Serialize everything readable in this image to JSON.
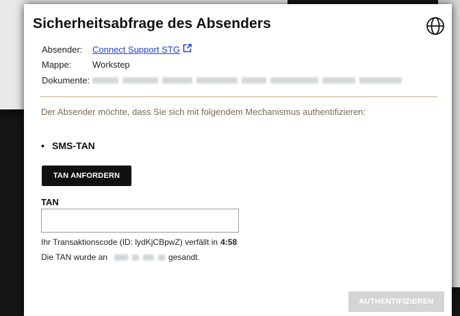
{
  "dialog": {
    "title": "Sicherheitsabfrage des Absenders",
    "language_icon": "globe-icon"
  },
  "meta": {
    "sender_label": "Absender:",
    "sender_name": "Connect Support STG",
    "sender_link_icon": "external-link-icon",
    "folder_label": "Mappe:",
    "folder_value": "Workstep",
    "documents_label": "Dokumente:"
  },
  "auth": {
    "mechanism_note": "Der Absender möchte, dass Sie sich mit folgendem Mechanismus authentifizieren:",
    "bullet": "•",
    "method": "SMS-TAN",
    "request_button": "TAN ANFORDERN",
    "tan_label": "TAN",
    "tan_value": "",
    "tan_placeholder": "",
    "transaction_text": "Ihr Transaktionscode (ID: lydKjCBpwZ) verfällt in",
    "countdown": "4:58",
    "sent_prefix": "Die TAN wurde an",
    "sent_suffix": "gesandt.",
    "submit_button": "AUTHENTIFIZIEREN"
  },
  "colors": {
    "link": "#1e3fcf",
    "divider": "#c7ad82",
    "note_text": "#7a6a53",
    "primary_button": "#111111",
    "disabled_button": "#d4d4d4"
  }
}
